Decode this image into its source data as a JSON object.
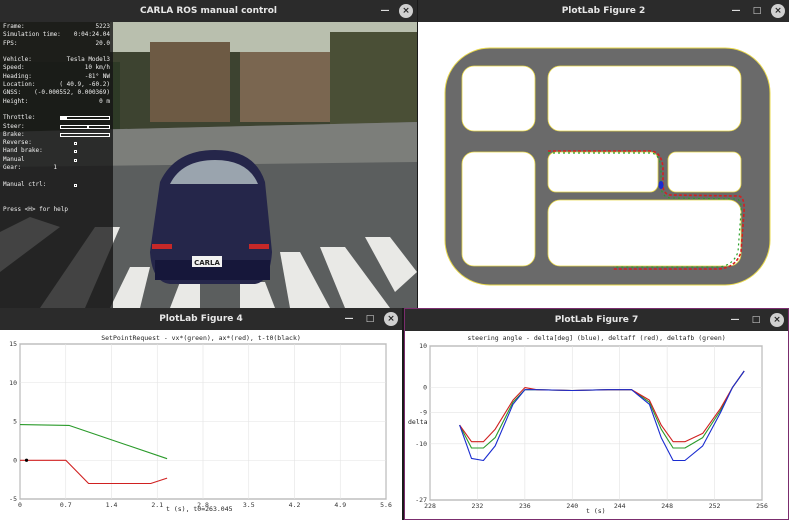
{
  "windows": {
    "camera": {
      "title": "CARLA ROS manual control"
    },
    "map": {
      "title": "PlotLab Figure 2"
    },
    "fig4": {
      "title": "PlotLab Figure 4"
    },
    "fig7": {
      "title": "PlotLab Figure 7"
    }
  },
  "controls": {
    "minimize": "—",
    "maximize": "□",
    "close": "×"
  },
  "hud": {
    "frame_label": "Frame:",
    "frame": "5223",
    "sim_time_label": "Simulation time:",
    "sim_time": "0:04:24.04",
    "fps_label": "FPS:",
    "fps": "20.0",
    "vehicle_label": "Vehicle:",
    "vehicle": "Tesla Model3",
    "speed_label": "Speed:",
    "speed": "10 km/h",
    "heading_label": "Heading:",
    "heading": "-81° NW",
    "location_label": "Location:",
    "location": "( 40.9, -60.2)",
    "gnss_label": "GNSS:",
    "gnss": "(-0.000552, 0.000369)",
    "height_label": "Height:",
    "height": "0 m",
    "throttle_label": "Throttle:",
    "throttle_level": 0.12,
    "steer_label": "Steer:",
    "steer_level": 0.55,
    "brake_label": "Brake:",
    "brake_level": 0.0,
    "reverse_label": "Reverse:",
    "hand_brake_label": "Hand brake:",
    "manual_label": "Manual",
    "gear_label": "Gear:",
    "gear": "1",
    "manual_ctrl_label": "Manual ctrl:",
    "help": "Press <H> for help"
  },
  "scene": {
    "plate": "CARLA"
  },
  "colors": {
    "road": "#6a6a6a",
    "track_red": "#d42020",
    "track_green": "#2aa02a",
    "track_blue": "#1a2cd0",
    "edge_yellow": "#e8d84a"
  },
  "fig4": {
    "plot_title": "SetPointRequest - vx*(green), ax*(red), t-t0(black)",
    "x_axis_label": "t (s), t0=263.045"
  },
  "fig7": {
    "plot_title": "steering angle - delta[deg] (blue), deltaff (red), deltafb (green)",
    "y_axis_label": "delta",
    "x_axis_label": "t (s)"
  },
  "chart_data": [
    {
      "type": "line",
      "title": "SetPointRequest - vx*(green), ax*(red), t-t0(black)",
      "xlabel": "t (s), t0=263.045",
      "ylabel": "",
      "xlim": [
        0,
        5.6
      ],
      "ylim": [
        -5,
        15
      ],
      "x_ticks": [
        "0",
        "0.7",
        "1.4",
        "2.1",
        "2.8",
        "3.5",
        "4.2",
        "4.9",
        "5.6"
      ],
      "y_ticks": [
        "-5",
        "0",
        "5",
        "10",
        "15"
      ],
      "series": [
        {
          "color": "#2a9a2a",
          "x": [
            0,
            0.75,
            2.25
          ],
          "y": [
            4.6,
            4.5,
            0.2
          ]
        },
        {
          "color": "#d02020",
          "x": [
            0,
            0.7,
            1.05,
            2.0,
            2.25
          ],
          "y": [
            0.0,
            0.0,
            -3.0,
            -3.0,
            -2.3
          ]
        },
        {
          "color": "#000000",
          "x": [
            0.1
          ],
          "y": [
            0.0
          ]
        }
      ]
    },
    {
      "type": "line",
      "title": "steering angle - delta[deg] (blue), deltaff (red), deltafb (green)",
      "xlabel": "t (s)",
      "ylabel": "delta",
      "xlim": [
        228,
        256
      ],
      "ylim": [
        -27,
        10
      ],
      "x_ticks": [
        "228",
        "232",
        "236",
        "240",
        "244",
        "248",
        "252",
        "256"
      ],
      "y_ticks": [
        "10",
        "0",
        "-9",
        "-10",
        "-27"
      ],
      "series": [
        {
          "color": "#2a9a2a",
          "x": [
            230.5,
            231.5,
            232.5,
            233.5,
            235,
            236,
            237,
            240,
            243,
            245,
            246.5,
            247.5,
            248.5,
            249.5,
            251,
            252.5,
            253.5,
            254.5
          ],
          "y": [
            -9,
            -14.5,
            -14.5,
            -12,
            -3.5,
            -0.5,
            -0.5,
            -0.7,
            -0.5,
            -0.5,
            -3.5,
            -10,
            -14.5,
            -14.5,
            -12,
            -5.5,
            0,
            4
          ]
        },
        {
          "color": "#d02020",
          "x": [
            230.5,
            231.5,
            232.5,
            233.5,
            235,
            236,
            237,
            240,
            243,
            245,
            246.5,
            247.5,
            248.5,
            249.5,
            251,
            252.5,
            253.5,
            254.5
          ],
          "y": [
            -9,
            -13,
            -13,
            -10,
            -3,
            0,
            -0.5,
            -0.7,
            -0.5,
            -0.5,
            -3,
            -9,
            -13,
            -13,
            -11,
            -5,
            0,
            4
          ]
        },
        {
          "color": "#1a2cd0",
          "x": [
            230.5,
            231.5,
            232.5,
            233.5,
            235,
            236,
            237,
            240,
            243,
            245,
            246.5,
            247.5,
            248.5,
            249.5,
            251,
            252.5,
            253.5,
            254.5
          ],
          "y": [
            -9,
            -17,
            -17.5,
            -14,
            -4,
            -0.5,
            -0.5,
            -0.7,
            -0.5,
            -0.5,
            -4,
            -12,
            -17.5,
            -17.5,
            -14,
            -6,
            0,
            4
          ]
        }
      ]
    }
  ]
}
